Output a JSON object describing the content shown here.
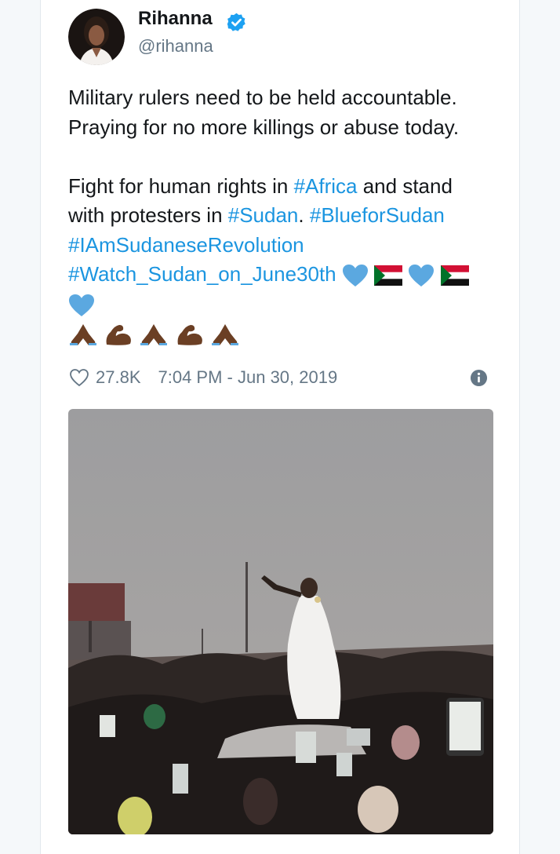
{
  "author": {
    "name": "Rihanna",
    "handle": "@rihanna",
    "verified_icon": "verified-badge-icon"
  },
  "tweet": {
    "line1": "Military rulers need to be held accountable.",
    "line2": "Praying for no more killings or abuse today.",
    "line3_pre": "Fight for human rights in ",
    "tag_africa": "#Africa",
    "line3_post": " and stand",
    "line4_pre": "with protesters in ",
    "tag_sudan": "#Sudan",
    "line4_mid": ". ",
    "tag_blue": "#BlueforSudan",
    "tag_iam": "#IAmSudaneseRevolution",
    "tag_watch": "#Watch_Sudan_on_June30th",
    "emoji_row": [
      "blue-heart-icon",
      "sudan-flag-icon",
      "blue-heart-icon",
      "sudan-flag-icon",
      "blue-heart-icon"
    ],
    "hands_row": [
      "folded-hands-icon",
      "flexed-biceps-icon",
      "folded-hands-icon",
      "flexed-biceps-icon",
      "folded-hands-icon"
    ]
  },
  "meta": {
    "likes": "27.8K",
    "timestamp": "7:04 PM - Jun 30, 2019",
    "like_icon": "heart-outline-icon",
    "info_icon": "info-icon"
  },
  "media": {
    "type": "photo",
    "subject": "protest-crowd-photo"
  },
  "colors": {
    "link": "#1b95e0",
    "secondary": "#657786",
    "verified": "#1da1f2",
    "heart_blue": "#5ba8e0",
    "flag_green": "#007229",
    "flag_red": "#d21034"
  }
}
